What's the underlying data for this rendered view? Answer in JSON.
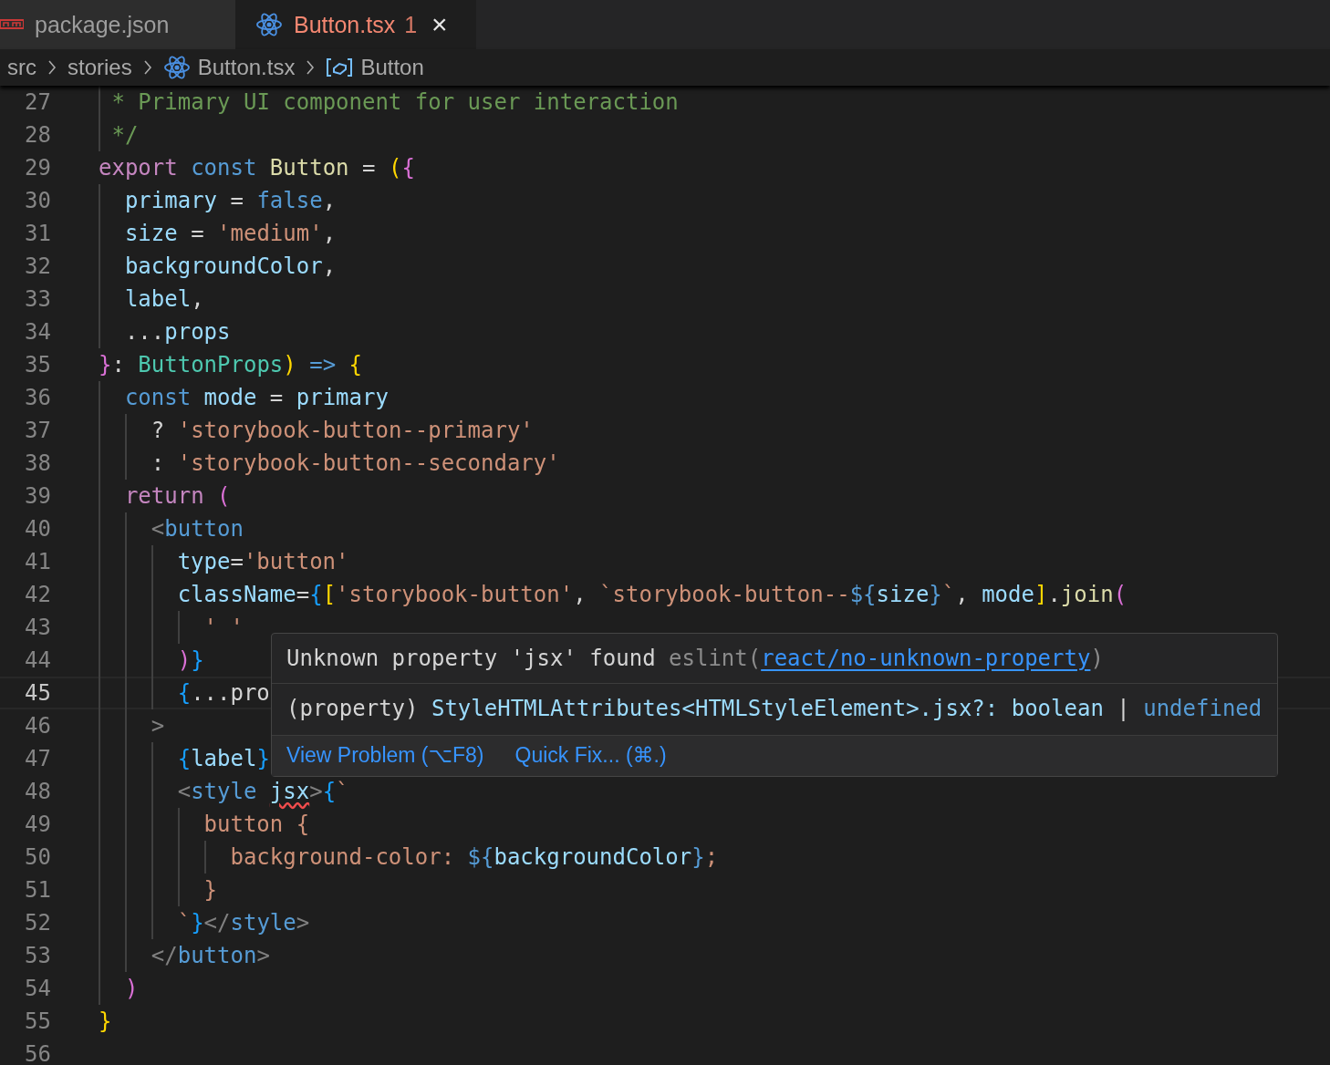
{
  "tabs": [
    {
      "label": "package.json",
      "kind": "npm",
      "selected": false
    },
    {
      "label": "Button.tsx",
      "kind": "react",
      "selected": true,
      "problems": "1",
      "close": "×"
    }
  ],
  "breadcrumb": [
    {
      "label": "src",
      "kind": "folder"
    },
    {
      "label": "stories",
      "kind": "folder"
    },
    {
      "label": "Button.tsx",
      "kind": "react"
    },
    {
      "label": "Button",
      "kind": "symbol"
    }
  ],
  "editor": {
    "lines": [
      {
        "number": "27",
        "current": false,
        "tokens": [
          {
            "kind": "comment",
            "text": " * Primary UI component for user interaction"
          }
        ]
      },
      {
        "number": "28",
        "current": false,
        "tokens": [
          {
            "kind": "comment",
            "text": " */"
          }
        ]
      },
      {
        "number": "29",
        "current": false,
        "tokens": [
          {
            "kind": "keyword",
            "text": "export "
          },
          {
            "kind": "storage",
            "text": "const "
          },
          {
            "kind": "function",
            "text": "Button"
          },
          {
            "kind": "plain",
            "text": " = "
          },
          {
            "kind": "bracket1",
            "text": "("
          },
          {
            "kind": "bracket2",
            "text": "{"
          }
        ]
      },
      {
        "number": "30",
        "current": false,
        "tokens": [
          {
            "kind": "variable",
            "text": "  primary"
          },
          {
            "kind": "plain",
            "text": " = "
          },
          {
            "kind": "storage",
            "text": "false"
          },
          {
            "kind": "plain",
            "text": ","
          }
        ]
      },
      {
        "number": "31",
        "current": false,
        "tokens": [
          {
            "kind": "variable",
            "text": "  size"
          },
          {
            "kind": "plain",
            "text": " = "
          },
          {
            "kind": "string",
            "text": "'medium'"
          },
          {
            "kind": "plain",
            "text": ","
          }
        ]
      },
      {
        "number": "32",
        "current": false,
        "tokens": [
          {
            "kind": "variable",
            "text": "  backgroundColor"
          },
          {
            "kind": "plain",
            "text": ","
          }
        ]
      },
      {
        "number": "33",
        "current": false,
        "tokens": [
          {
            "kind": "variable",
            "text": "  label"
          },
          {
            "kind": "plain",
            "text": ","
          }
        ]
      },
      {
        "number": "34",
        "current": false,
        "tokens": [
          {
            "kind": "plain",
            "text": "  ..."
          },
          {
            "kind": "variable",
            "text": "props"
          }
        ]
      },
      {
        "number": "35",
        "current": false,
        "tokens": [
          {
            "kind": "bracket2",
            "text": "}"
          },
          {
            "kind": "plain",
            "text": ": "
          },
          {
            "kind": "type",
            "text": "ButtonProps"
          },
          {
            "kind": "bracket1",
            "text": ")"
          },
          {
            "kind": "storage",
            "text": " => "
          },
          {
            "kind": "bracket1",
            "text": "{"
          }
        ]
      },
      {
        "number": "36",
        "current": false,
        "tokens": [
          {
            "kind": "storage",
            "text": "  const "
          },
          {
            "kind": "variable",
            "text": "mode"
          },
          {
            "kind": "plain",
            "text": " = "
          },
          {
            "kind": "variable",
            "text": "primary"
          }
        ]
      },
      {
        "number": "37",
        "current": false,
        "tokens": [
          {
            "kind": "plain",
            "text": "    ? "
          },
          {
            "kind": "string",
            "text": "'storybook-button--primary'"
          }
        ]
      },
      {
        "number": "38",
        "current": false,
        "tokens": [
          {
            "kind": "plain",
            "text": "    : "
          },
          {
            "kind": "string",
            "text": "'storybook-button--secondary'"
          }
        ]
      },
      {
        "number": "39",
        "current": false,
        "tokens": [
          {
            "kind": "keyword",
            "text": "  return "
          },
          {
            "kind": "bracket2",
            "text": "("
          }
        ]
      },
      {
        "number": "40",
        "current": false,
        "tokens": [
          {
            "kind": "tagpunct",
            "text": "    <"
          },
          {
            "kind": "tag",
            "text": "button"
          }
        ]
      },
      {
        "number": "41",
        "current": false,
        "tokens": [
          {
            "kind": "variable",
            "text": "      type"
          },
          {
            "kind": "plain",
            "text": "="
          },
          {
            "kind": "string",
            "text": "'button'"
          }
        ]
      },
      {
        "number": "42",
        "current": false,
        "tokens": [
          {
            "kind": "variable",
            "text": "      className"
          },
          {
            "kind": "plain",
            "text": "="
          },
          {
            "kind": "bracket3",
            "text": "{"
          },
          {
            "kind": "bracket1",
            "text": "["
          },
          {
            "kind": "string",
            "text": "'storybook-button'"
          },
          {
            "kind": "plain",
            "text": ", "
          },
          {
            "kind": "string",
            "text": "`storybook-button--"
          },
          {
            "kind": "storage",
            "text": "${"
          },
          {
            "kind": "variable",
            "text": "size"
          },
          {
            "kind": "storage",
            "text": "}"
          },
          {
            "kind": "string",
            "text": "`"
          },
          {
            "kind": "plain",
            "text": ", "
          },
          {
            "kind": "variable",
            "text": "mode"
          },
          {
            "kind": "bracket1",
            "text": "]"
          },
          {
            "kind": "plain",
            "text": "."
          },
          {
            "kind": "function",
            "text": "join"
          },
          {
            "kind": "bracket2",
            "text": "("
          }
        ]
      },
      {
        "number": "43",
        "current": false,
        "tokens": [
          {
            "kind": "string",
            "text": "        ' '"
          }
        ]
      },
      {
        "number": "44",
        "current": false,
        "tokens": [
          {
            "kind": "bracket2",
            "text": "      )"
          },
          {
            "kind": "bracket3",
            "text": "}"
          }
        ]
      },
      {
        "number": "45",
        "current": true,
        "tokens": [
          {
            "kind": "bracket3",
            "text": "      {"
          },
          {
            "kind": "plain",
            "text": "...pro"
          }
        ]
      },
      {
        "number": "46",
        "current": false,
        "tokens": [
          {
            "kind": "tagpunct",
            "text": "    >"
          }
        ]
      },
      {
        "number": "47",
        "current": false,
        "tokens": [
          {
            "kind": "bracket3",
            "text": "      {"
          },
          {
            "kind": "variable",
            "text": "label"
          },
          {
            "kind": "bracket3",
            "text": "}"
          }
        ]
      },
      {
        "number": "48",
        "current": false,
        "tokens": [
          {
            "kind": "tagpunct",
            "text": "      <"
          },
          {
            "kind": "tag",
            "text": "style "
          },
          {
            "kind": "error",
            "text": "jsx"
          },
          {
            "kind": "tagpunct",
            "text": ">"
          },
          {
            "kind": "bracket3",
            "text": "{"
          },
          {
            "kind": "string",
            "text": "`"
          }
        ]
      },
      {
        "number": "49",
        "current": false,
        "tokens": [
          {
            "kind": "string",
            "text": "        button {"
          }
        ]
      },
      {
        "number": "50",
        "current": false,
        "tokens": [
          {
            "kind": "string",
            "text": "          background-color: "
          },
          {
            "kind": "storage",
            "text": "${"
          },
          {
            "kind": "variable",
            "text": "backgroundColor"
          },
          {
            "kind": "storage",
            "text": "}"
          },
          {
            "kind": "string",
            "text": ";"
          }
        ]
      },
      {
        "number": "51",
        "current": false,
        "tokens": [
          {
            "kind": "string",
            "text": "        }"
          }
        ]
      },
      {
        "number": "52",
        "current": false,
        "tokens": [
          {
            "kind": "string",
            "text": "      `"
          },
          {
            "kind": "bracket3",
            "text": "}"
          },
          {
            "kind": "tagpunct",
            "text": "</"
          },
          {
            "kind": "tag",
            "text": "style"
          },
          {
            "kind": "tagpunct",
            "text": ">"
          }
        ]
      },
      {
        "number": "53",
        "current": false,
        "tokens": [
          {
            "kind": "tagpunct",
            "text": "    </"
          },
          {
            "kind": "tag",
            "text": "button"
          },
          {
            "kind": "tagpunct",
            "text": ">"
          }
        ]
      },
      {
        "number": "54",
        "current": false,
        "tokens": [
          {
            "kind": "bracket2",
            "text": "  )"
          }
        ]
      },
      {
        "number": "55",
        "current": false,
        "tokens": [
          {
            "kind": "bracket1",
            "text": "}"
          }
        ]
      },
      {
        "number": "56",
        "current": false
      }
    ]
  },
  "hover": {
    "message": "Unknown property 'jsx' found ",
    "source": "eslint(",
    "link": "react/no-unknown-property",
    "source_end": ")",
    "signature": [
      {
        "kind": "plain",
        "text": "(property) "
      },
      {
        "kind": "variable",
        "text": "StyleHTMLAttributes<HTMLStyleElement>.jsx?: boolean "
      },
      {
        "kind": "plain",
        "text": "| "
      },
      {
        "kind": "storage",
        "text": "undefined"
      }
    ],
    "actions": [
      "View Problem (⌥F8)",
      "Quick Fix... (⌘.)"
    ]
  }
}
